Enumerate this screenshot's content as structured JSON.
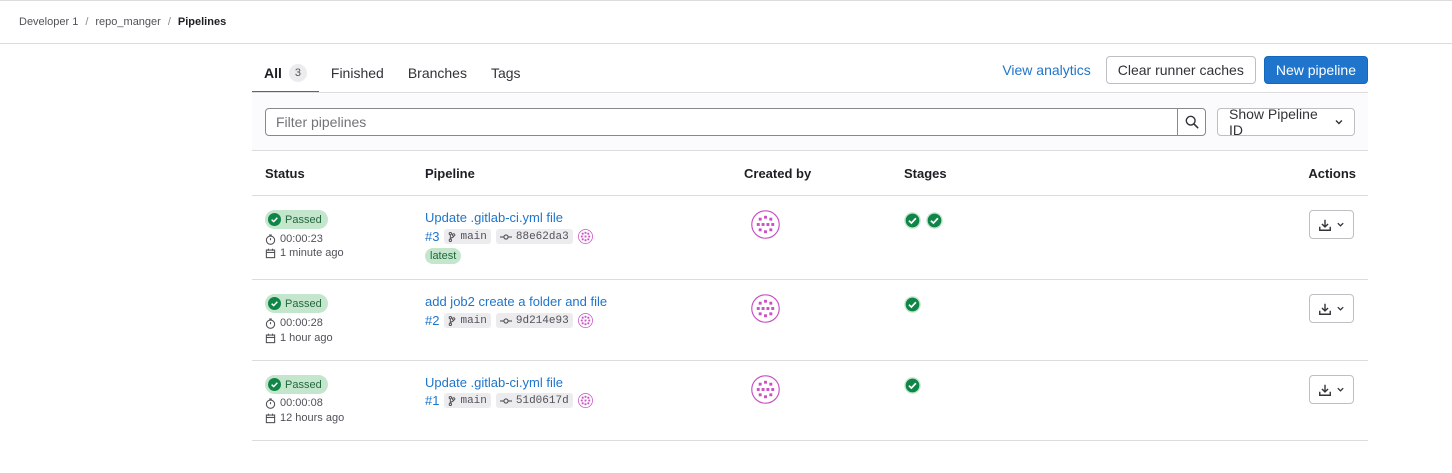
{
  "breadcrumb": [
    {
      "label": "Developer 1"
    },
    {
      "label": "repo_manger"
    },
    {
      "label": "Pipelines"
    }
  ],
  "tabs": [
    {
      "label": "All",
      "count": "3",
      "active": true
    },
    {
      "label": "Finished"
    },
    {
      "label": "Branches"
    },
    {
      "label": "Tags"
    }
  ],
  "header_actions": {
    "analytics": "View analytics",
    "clear_caches": "Clear runner caches",
    "new_pipeline": "New pipeline"
  },
  "filter": {
    "placeholder": "Filter pipelines",
    "dropdown_label": "Show Pipeline ID"
  },
  "table": {
    "headers": [
      "Status",
      "Pipeline",
      "Created by",
      "Stages",
      "Actions"
    ],
    "rows": [
      {
        "status": "Passed",
        "duration": "00:00:23",
        "finished": "1 minute ago",
        "title": "Update .gitlab-ci.yml file",
        "id": "#3",
        "branch": "main",
        "commit": "88e62da3",
        "tag": "latest",
        "stages": [
          "passed",
          "passed"
        ]
      },
      {
        "status": "Passed",
        "duration": "00:00:28",
        "finished": "1 hour ago",
        "title": "add job2 create a folder and file",
        "id": "#2",
        "branch": "main",
        "commit": "9d214e93",
        "stages": [
          "passed"
        ]
      },
      {
        "status": "Passed",
        "duration": "00:00:08",
        "finished": "12 hours ago",
        "title": "Update .gitlab-ci.yml file",
        "id": "#1",
        "branch": "main",
        "commit": "51d0617d",
        "stages": [
          "passed"
        ]
      }
    ]
  },
  "colors": {
    "link": "#1f75cb",
    "success": "#108548",
    "success_bg": "#c3e6cd",
    "avatar": "#c94fc4"
  }
}
